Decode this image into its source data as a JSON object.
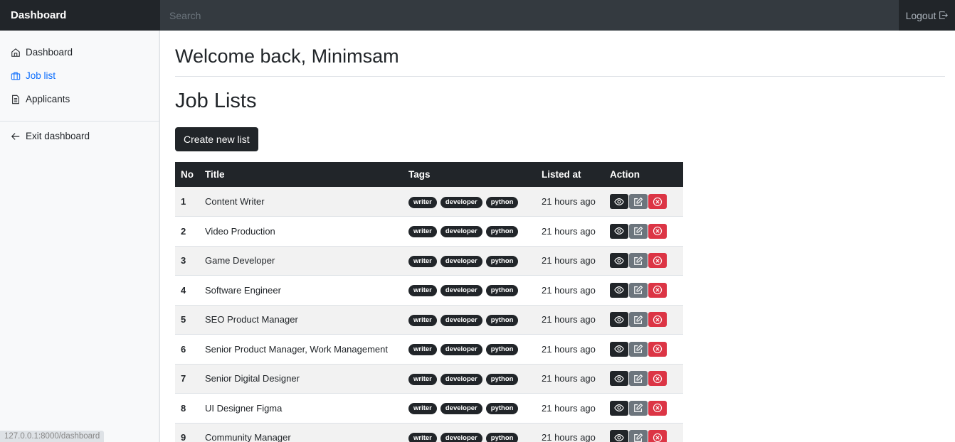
{
  "topbar": {
    "brand": "Dashboard",
    "search_placeholder": "Search",
    "logout_label": "Logout"
  },
  "sidebar": {
    "items": [
      {
        "label": "Dashboard",
        "icon": "home-icon"
      },
      {
        "label": "Job list",
        "icon": "briefcase-icon",
        "active": true
      },
      {
        "label": "Applicants",
        "icon": "document-icon"
      }
    ],
    "exit_label": "Exit dashboard",
    "status_url": "127.0.0.1:8000/dashboard"
  },
  "main": {
    "welcome": "Welcome back, Minimsam",
    "section_title": "Job Lists",
    "create_button": "Create new list",
    "table": {
      "headers": [
        "No",
        "Title",
        "Tags",
        "Listed at",
        "Action"
      ],
      "rows": [
        {
          "no": "1",
          "title": "Content Writer",
          "tags": [
            "writer",
            "developer",
            "python"
          ],
          "listed": "21 hours ago"
        },
        {
          "no": "2",
          "title": "Video Production",
          "tags": [
            "writer",
            "developer",
            "python"
          ],
          "listed": "21 hours ago"
        },
        {
          "no": "3",
          "title": "Game Developer",
          "tags": [
            "writer",
            "developer",
            "python"
          ],
          "listed": "21 hours ago"
        },
        {
          "no": "4",
          "title": "Software Engineer",
          "tags": [
            "writer",
            "developer",
            "python"
          ],
          "listed": "21 hours ago"
        },
        {
          "no": "5",
          "title": "SEO Product Manager",
          "tags": [
            "writer",
            "developer",
            "python"
          ],
          "listed": "21 hours ago"
        },
        {
          "no": "6",
          "title": "Senior Product Manager, Work Management",
          "tags": [
            "writer",
            "developer",
            "python"
          ],
          "listed": "21 hours ago"
        },
        {
          "no": "7",
          "title": "Senior Digital Designer",
          "tags": [
            "writer",
            "developer",
            "python"
          ],
          "listed": "21 hours ago"
        },
        {
          "no": "8",
          "title": "UI Designer Figma",
          "tags": [
            "writer",
            "developer",
            "python"
          ],
          "listed": "21 hours ago"
        },
        {
          "no": "9",
          "title": "Community Manager",
          "tags": [
            "writer",
            "developer",
            "python"
          ],
          "listed": "21 hours ago"
        }
      ]
    }
  },
  "colors": {
    "dark": "#212529",
    "topbar": "#343a40",
    "active_link": "#0d6efd",
    "edit": "#6c757d",
    "delete": "#dc3545"
  }
}
